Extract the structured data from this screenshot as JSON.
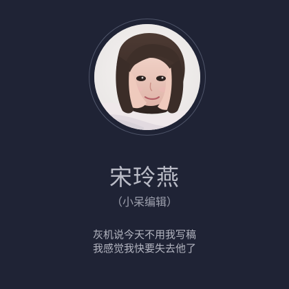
{
  "profile": {
    "avatar_icon": "profile-photo",
    "name": "宋玲燕",
    "subtitle": "（小呆编辑）",
    "bio_lines": [
      "灰机说今天不用我写稿",
      "我感觉我快要失去他了"
    ]
  },
  "colors": {
    "background": "#1f2335",
    "name": "#b9bbc6",
    "text": "#b3b5c0"
  }
}
